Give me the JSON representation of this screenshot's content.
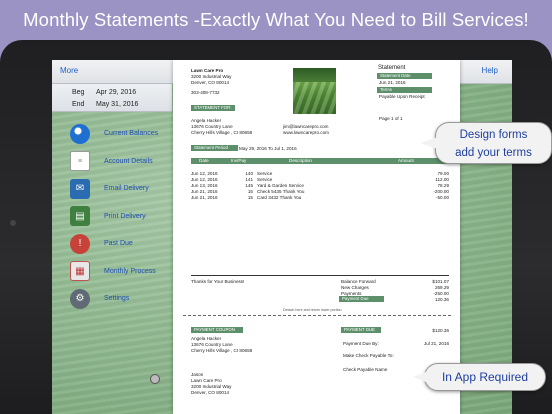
{
  "banner": "Monthly Statements -Exactly What You  Need to Bill Services!",
  "topbar": {
    "more": "More",
    "help": "Help"
  },
  "dates": {
    "beg_label": "Beg",
    "beg": "Apr 29, 2016",
    "end_label": "End",
    "end": "May 31, 2016"
  },
  "menu": [
    {
      "label": "Current Balances",
      "icon": "pie-chart-icon"
    },
    {
      "label": "Account Details",
      "icon": "document-icon"
    },
    {
      "label": "Email Delivery",
      "icon": "envelope-icon"
    },
    {
      "label": "Print Delivery",
      "icon": "printer-icon"
    },
    {
      "label": "Past Due",
      "icon": "past-due-icon"
    },
    {
      "label": "Monthly Process",
      "icon": "calendar-icon"
    },
    {
      "label": "Settings",
      "icon": "gear-icon"
    }
  ],
  "statement": {
    "company": "Lawn Care Pro",
    "address1": "3200 Industrial Way",
    "address2": "Denver, CO 80014",
    "phone": "303-408-7732",
    "title": "Statement",
    "date_label": "Statement Date",
    "date": "Jun 21, 2016",
    "terms_label": "Terms",
    "terms": "Payable Upon Receipt",
    "page": "Page 1 of 1",
    "for_label": "STATEMENT FOR:",
    "customer_name": "Angela Hacker",
    "customer_addr1": "13676 Country Lane",
    "customer_addr2": "Cherry Hills Village , CI 80658",
    "email": "jim@lawncarepro.com",
    "web": "www.lawncarepro.com",
    "period_label": "Statement Period",
    "period": "May 29, 2016 To Jul 1, 2016",
    "columns": [
      "Date",
      "Inv/Pay",
      "Description",
      "Amount"
    ],
    "rows": [
      {
        "date": "Jun 12, 2016",
        "inv": "140",
        "desc": "Service",
        "amt": "79.00"
      },
      {
        "date": "Jun 12, 2016",
        "inv": "141",
        "desc": "Service",
        "amt": "112.00"
      },
      {
        "date": "Jun 13, 2016",
        "inv": "145",
        "desc": "Yard & Garden Service",
        "amt": "78.29"
      },
      {
        "date": "Jun 21, 2016",
        "inv": "15",
        "desc": "Check 5435 Thank You",
        "amt": "-200.00"
      },
      {
        "date": "Jun 21, 2016",
        "inv": "15",
        "desc": "Card 3432 Thank You",
        "amt": "-50.00"
      }
    ],
    "thanks": "Thanks for Your Business!",
    "totals": [
      {
        "label": "Balance Forward",
        "value": "$101.07"
      },
      {
        "label": "New Charges",
        "value": "269.29"
      },
      {
        "label": "Payments",
        "value": "-250.00"
      },
      {
        "label": "Payment Due",
        "value": "120.36"
      }
    ],
    "detach": "Detach here and return lower portion",
    "coupon_label": "PAYMENT COUPON",
    "coupon_due_label": "PAYMENT DUE",
    "coupon_due_value": "$120.36",
    "coupon_due_by_label": "Payment Due By:",
    "coupon_due_by": "Jul 21, 2016",
    "make_check": "Make Check Payable To:",
    "check_name": "Check Payable Name",
    "remit_name": "Jason",
    "remit_company": "Lawn Care Pro",
    "remit_addr1": "3200 Industrial Way",
    "remit_addr2": "Denver, CO 80014"
  },
  "callouts": {
    "design": "Design forms add your terms",
    "design_line1": "Design forms",
    "design_line2": "add your terms",
    "inapp": "In App Required"
  },
  "colors": {
    "banner_bg": "#9a93c4",
    "accent_green": "#5d8f6b",
    "link_blue": "#1f5fc7"
  }
}
